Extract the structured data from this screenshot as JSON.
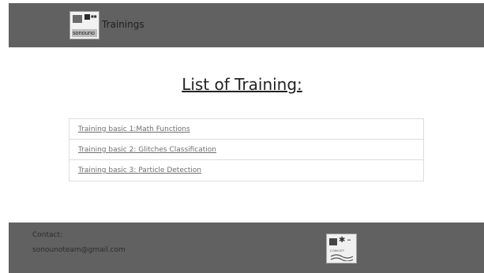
{
  "header": {
    "logo": {
      "icon": "sonouno-logo-icon",
      "text": "sonouno"
    },
    "title": "Trainings"
  },
  "main": {
    "heading": "List of Training:",
    "trainings": [
      {
        "label": "Training basic 1:Math Functions"
      },
      {
        "label": "Training basic 2: Glitches Classification"
      },
      {
        "label": "Training basic 3: Particle Detection"
      }
    ]
  },
  "footer": {
    "contact_label": "Contact:",
    "email": "sonounoteam@gmail.com",
    "logo": {
      "icon": "conicet-logo-icon",
      "text": "CONICET"
    }
  },
  "colors": {
    "header_bg": "#616161",
    "footer_bg": "#616161",
    "link": "#6e6e6e",
    "heading": "#222222"
  }
}
